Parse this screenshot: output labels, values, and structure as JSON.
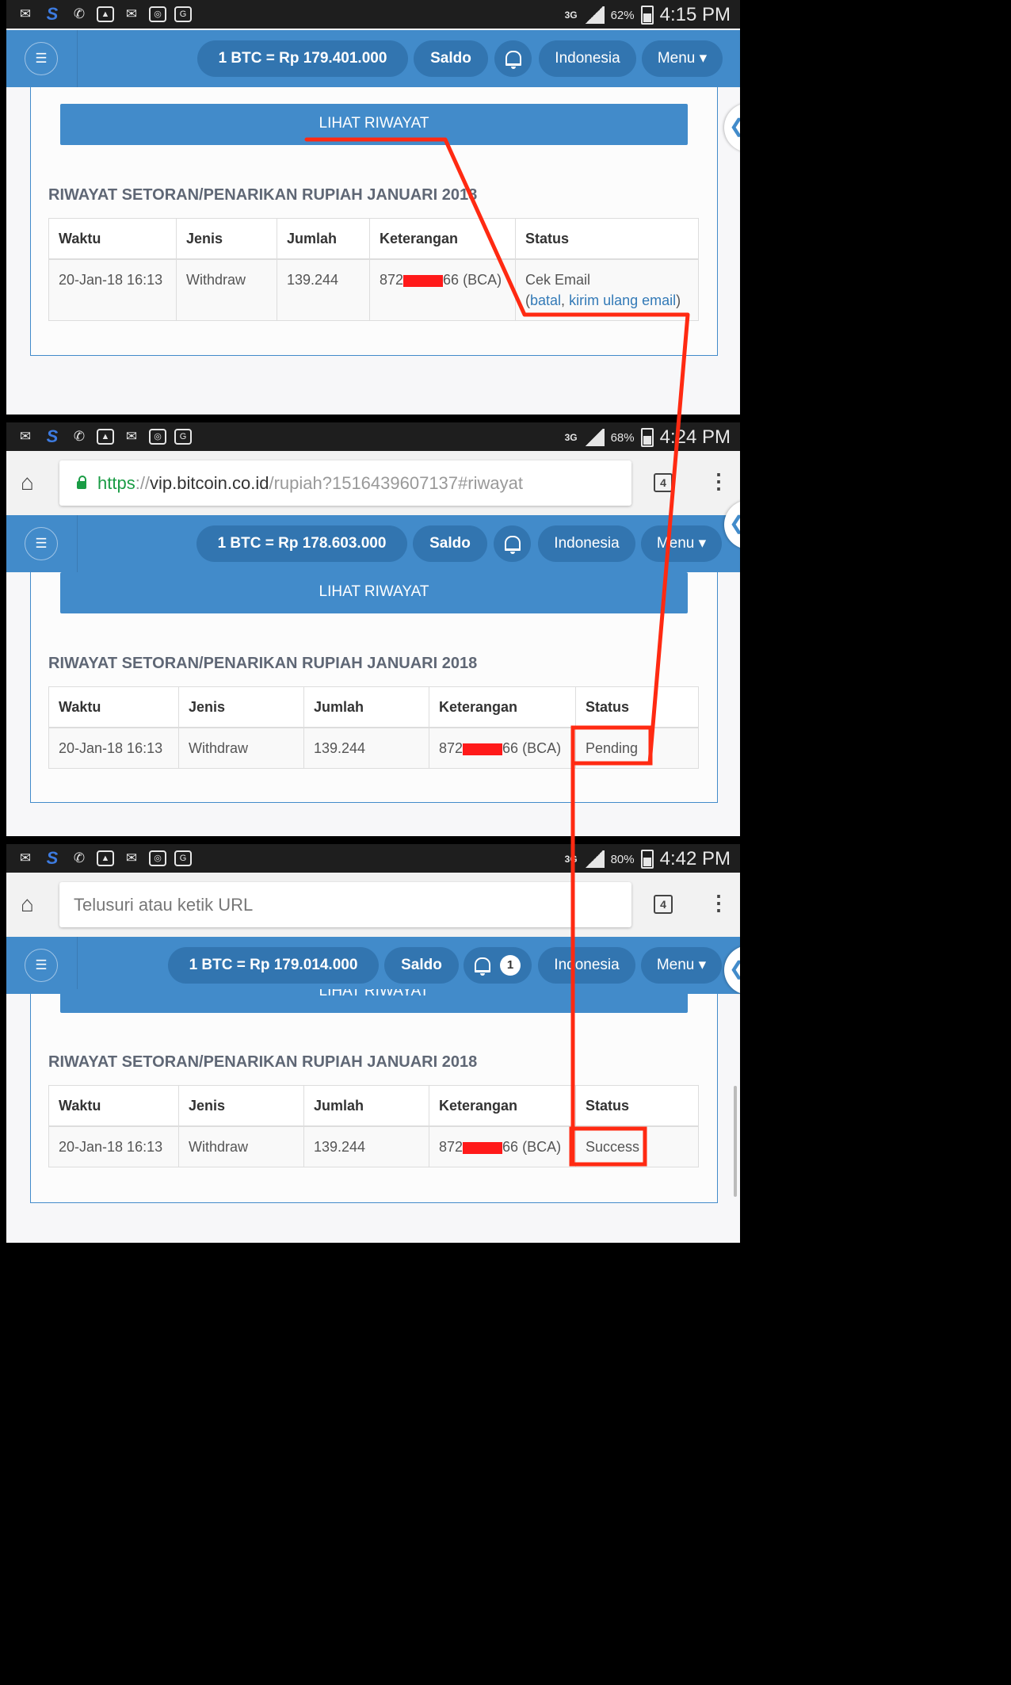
{
  "frames": [
    {
      "status_bar": {
        "network": "3G",
        "battery": "62%",
        "time": "4:15 PM"
      },
      "nav": {
        "price": "1 BTC = Rp 179.401.000",
        "saldo": "Saldo",
        "language": "Indonesia",
        "menu": "Menu ▾"
      },
      "riwayat_button": "LIHAT RIWAYAT",
      "section_title": "RIWAYAT SETORAN/PENARIKAN RUPIAH JANUARI 2018",
      "headers": [
        "Waktu",
        "Jenis",
        "Jumlah",
        "Keterangan",
        "Status"
      ],
      "row": {
        "waktu": "20-Jan-18 16:13",
        "jenis": "Withdraw",
        "jumlah": "139.244",
        "ket_prefix": "872",
        "ket_suffix": "66 (BCA)",
        "status": "Cek Email",
        "status_open": "(",
        "status_link_cancel": "batal",
        "status_comma": ",",
        "status_link_resend": "kirim ulang email",
        "status_close": ")"
      }
    },
    {
      "status_bar": {
        "network": "3G",
        "battery": "68%",
        "time": "4:24 PM"
      },
      "url": {
        "scheme": "https",
        "separator": "://",
        "domain": "vip.bitcoin.co.id",
        "path": "/rupiah?1516439607137#riwayat",
        "tab_count": "4"
      },
      "nav": {
        "price": "1 BTC = Rp 178.603.000",
        "saldo": "Saldo",
        "language": "Indonesia",
        "menu": "Menu ▾"
      },
      "riwayat_button": "LIHAT RIWAYAT",
      "section_title": "RIWAYAT SETORAN/PENARIKAN RUPIAH JANUARI 2018",
      "headers": [
        "Waktu",
        "Jenis",
        "Jumlah",
        "Keterangan",
        "Status"
      ],
      "row": {
        "waktu": "20-Jan-18 16:13",
        "jenis": "Withdraw",
        "jumlah": "139.244",
        "ket_prefix": "872",
        "ket_suffix": "66 (BCA)",
        "status": "Pending"
      }
    },
    {
      "status_bar": {
        "network": "3G",
        "battery": "80%",
        "time": "4:42 PM"
      },
      "url": {
        "placeholder": "Telusuri atau ketik URL",
        "tab_count": "4"
      },
      "nav": {
        "price": "1 BTC = Rp 179.014.000",
        "saldo": "Saldo",
        "notifications": "1",
        "language": "Indonesia",
        "menu": "Menu ▾"
      },
      "riwayat_button": "LIHAT RIWAYAT",
      "section_title": "RIWAYAT SETORAN/PENARIKAN RUPIAH JANUARI 2018",
      "headers": [
        "Waktu",
        "Jenis",
        "Jumlah",
        "Keterangan",
        "Status"
      ],
      "row": {
        "waktu": "20-Jan-18 16:13",
        "jenis": "Withdraw",
        "jumlah": "139.244",
        "ket_prefix": "872",
        "ket_suffix": "66 (BCA)",
        "status": "Success"
      }
    }
  ],
  "status_bar_icons": [
    "mail-icon",
    "s-app-icon",
    "whatsapp-icon",
    "gallery-icon",
    "email-at-icon",
    "instagram-icon",
    "location-icon"
  ],
  "colors": {
    "primary": "#428bca",
    "pill": "#3275b0",
    "annotation": "#ff2a12",
    "secure": "#1a9c45",
    "link": "#337ab7"
  }
}
